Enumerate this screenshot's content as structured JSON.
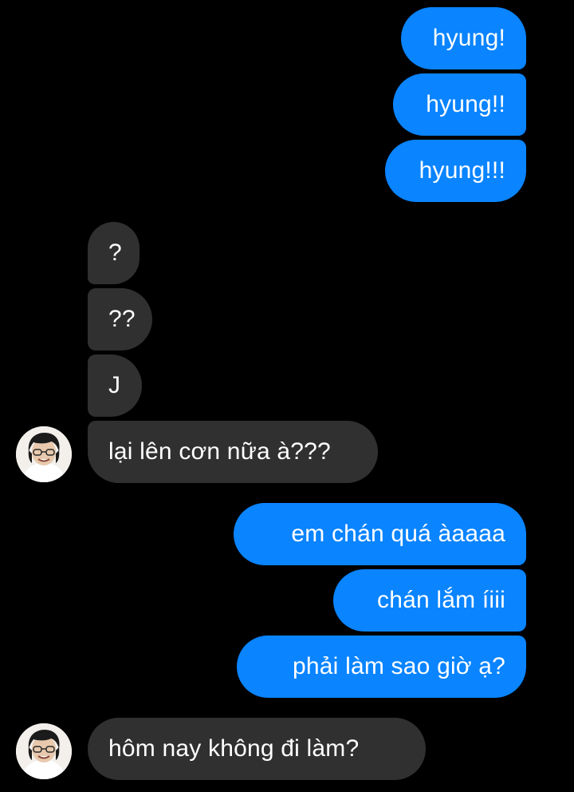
{
  "colors": {
    "background": "#000000",
    "sent_bubble": "#0a84ff",
    "received_bubble": "#303030",
    "text": "#ffffff"
  },
  "messages": [
    {
      "side": "sent",
      "text": "hyung!"
    },
    {
      "side": "sent",
      "text": "hyung!!"
    },
    {
      "side": "sent",
      "text": "hyung!!!"
    },
    {
      "side": "received",
      "text": "?"
    },
    {
      "side": "received",
      "text": "??"
    },
    {
      "side": "received",
      "text": "J"
    },
    {
      "side": "received",
      "text": "lại lên cơn nữa à???"
    },
    {
      "side": "sent",
      "text": "em chán quá àaaaa"
    },
    {
      "side": "sent",
      "text": "chán lắm íiii"
    },
    {
      "side": "sent",
      "text": "phải làm sao giờ ạ?"
    },
    {
      "side": "received",
      "text": "hôm nay không đi làm?"
    }
  ],
  "avatar_icon": "contact-avatar"
}
